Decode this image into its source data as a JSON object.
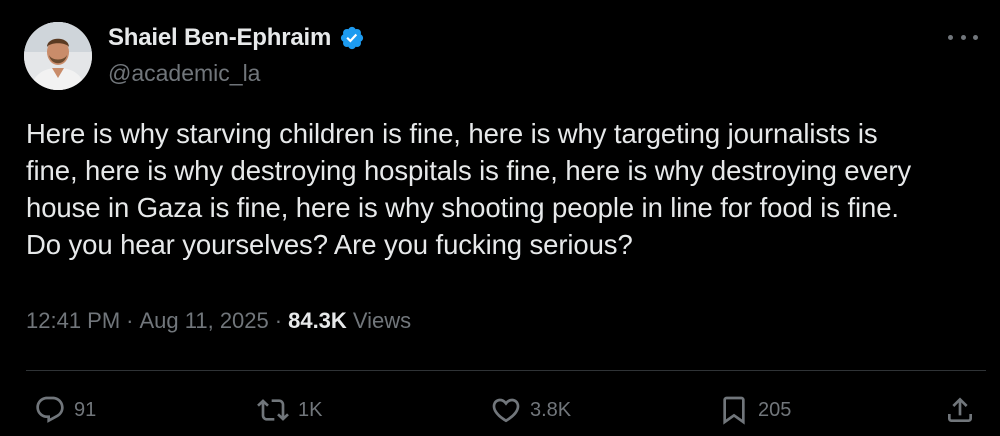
{
  "post": {
    "author": {
      "display_name": "Shaiel Ben-Ephraim",
      "handle": "@academic_la",
      "verified": true,
      "avatar_icon": "profile-photo"
    },
    "text": "Here is why starving children is fine, here is why targeting journalists is\nfine, here is why destroying hospitals is fine, here is why destroying every\nhouse in Gaza is fine, here is why shooting people in line for food is fine.\nDo you hear yourselves? Are you fucking serious?",
    "meta": {
      "time": "12:41 PM",
      "separator1": "·",
      "date": "Aug 11, 2025",
      "separator2": "·",
      "views_count": "84.3K",
      "views_label": "Views"
    },
    "actions": {
      "replies": "91",
      "reposts": "1K",
      "likes": "3.8K",
      "bookmarks": "205"
    }
  },
  "colors": {
    "background": "#000000",
    "text_primary": "#e7e9ea",
    "text_secondary": "#71767b",
    "verified_badge": "#1d9bf0",
    "divider": "#2f3336"
  }
}
